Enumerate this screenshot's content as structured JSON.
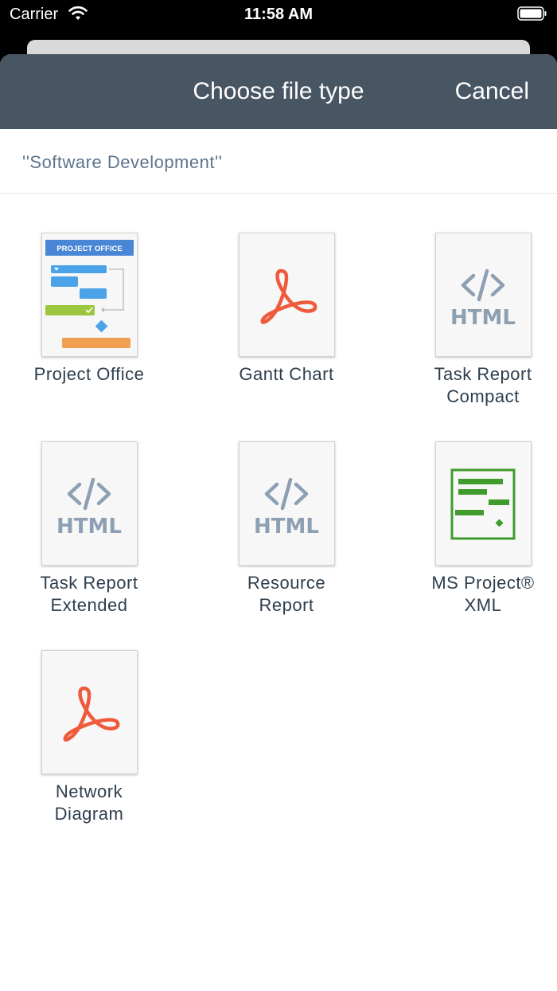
{
  "status_bar": {
    "carrier": "Carrier",
    "time": "11:58 AM"
  },
  "header": {
    "title": "Choose file type",
    "cancel_label": "Cancel"
  },
  "project_name": "''Software Development''",
  "colors": {
    "navbar": "#485563",
    "pdf_red": "#f05a3c",
    "html_gray": "#8da0b3",
    "xml_green": "#3f9b2c"
  },
  "file_types": [
    {
      "lines": [
        "Project Office"
      ],
      "icon": "project-office-icon",
      "icon_text": "PROJECT OFFICE"
    },
    {
      "lines": [
        "Gantt Chart"
      ],
      "icon": "pdf-icon"
    },
    {
      "lines": [
        "Task Report",
        "Compact"
      ],
      "icon": "html-icon",
      "icon_text": "HTML"
    },
    {
      "lines": [
        "Task Report",
        "Extended"
      ],
      "icon": "html-icon",
      "icon_text": "HTML"
    },
    {
      "lines": [
        "Resource",
        "Report"
      ],
      "icon": "html-icon",
      "icon_text": "HTML"
    },
    {
      "lines": [
        "MS Project®",
        "XML"
      ],
      "icon": "ms-project-xml-icon"
    },
    {
      "lines": [
        "Network",
        "Diagram"
      ],
      "icon": "pdf-icon"
    }
  ]
}
